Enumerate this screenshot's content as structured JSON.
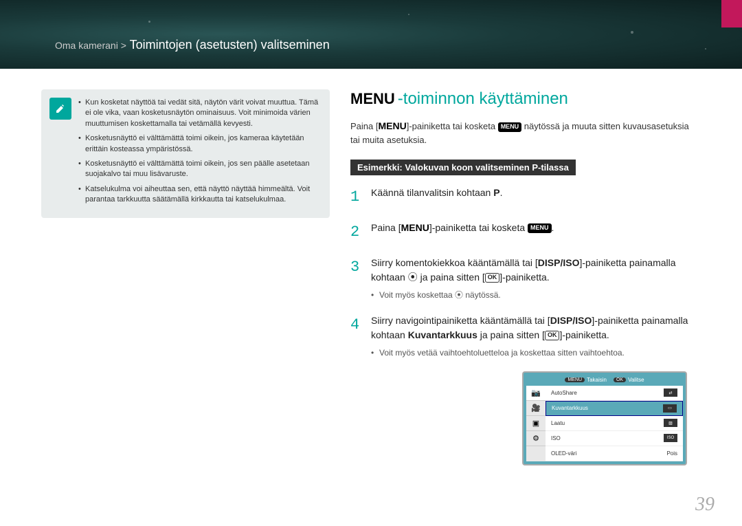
{
  "breadcrumb": {
    "prefix": "Oma kamerani >",
    "title": "Toimintojen (asetusten) valitseminen"
  },
  "notes": [
    "Kun kosketat näyttöä tai vedät sitä, näytön värit voivat muuttua. Tämä ei ole vika, vaan kosketusnäytön ominaisuus. Voit minimoida värien muuttumisen koskettamalla tai vetämällä kevyesti.",
    "Kosketusnäyttö ei välttämättä toimi oikein, jos kameraa käytetään erittäin kosteassa ympäristössä.",
    "Kosketusnäyttö ei välttämättä toimi oikein, jos sen päälle asetetaan suojakalvo tai muu lisävaruste.",
    "Katselukulma voi aiheuttaa sen, että näyttö näyttää himmeältä. Voit parantaa tarkkuutta säätämällä kirkkautta tai katselukulmaa."
  ],
  "section": {
    "menuLabel": "MENU",
    "titleSuffix": "-toiminnon käyttäminen"
  },
  "intro": {
    "part1": "Paina [",
    "part2": "]-painiketta tai kosketa ",
    "part3": " näytössä ja muuta sitten kuvausasetuksia tai muita asetuksia."
  },
  "example": {
    "prefix": "Esimerkki: Valokuvan koon valitseminen ",
    "mode": "P",
    "suffix": "-tilassa"
  },
  "steps": {
    "s1": {
      "a": "Käännä tilanvalitsin kohtaan ",
      "b": "."
    },
    "s2": {
      "a": "Paina [",
      "b": "]-painiketta tai kosketa ",
      "c": "."
    },
    "s3": {
      "a": "Siirry komentokiekkoa kääntämällä tai [",
      "b": "]-painiketta painamalla kohtaan ",
      "c": " ja paina sitten [",
      "d": "]-painiketta.",
      "sub": "Voit myös koskettaa ⦿ näytössä."
    },
    "s4": {
      "a": "Siirry navigointipainiketta kääntämällä tai [",
      "b": "]-painiketta painamalla kohtaan ",
      "bold": "Kuvantarkkuus",
      "c": " ja paina sitten [",
      "d": "]-painiketta.",
      "sub": "Voit myös vetää vaihtoehtoluetteloa ja koskettaa sitten vaihtoehtoa."
    }
  },
  "screen": {
    "top": {
      "backPill": "MENU",
      "back": "Takaisin",
      "okPill": "OK",
      "ok": "Valitse"
    },
    "rows": [
      {
        "label": "AutoShare",
        "val": ""
      },
      {
        "label": "Kuvantarkkuus",
        "val": ""
      },
      {
        "label": "Laatu",
        "val": ""
      },
      {
        "label": "ISO",
        "val": "ISO"
      },
      {
        "label": "OLED-väri",
        "val": "Pois"
      }
    ]
  },
  "labels": {
    "menuSmall": "MENU",
    "ok": "OK",
    "dispIso": "DISP/ISO",
    "pMode": "P",
    "camIcon": "⦿"
  },
  "pageNumber": "39"
}
